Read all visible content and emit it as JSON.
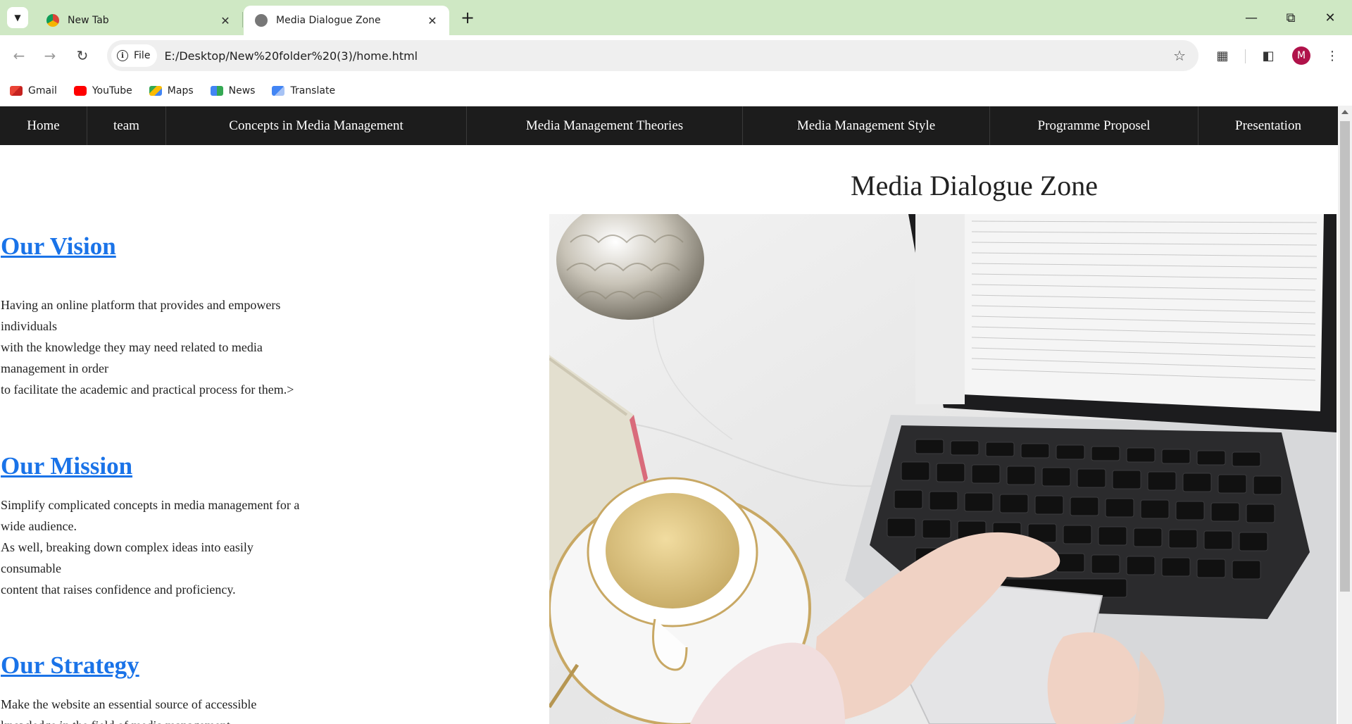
{
  "browser": {
    "tabs": [
      {
        "title": "New Tab",
        "active": false
      },
      {
        "title": "Media Dialogue Zone",
        "active": true
      }
    ],
    "address": {
      "scheme_chip": "File",
      "url": "E:/Desktop/New%20folder%20(3)/home.html"
    },
    "profile_initial": "M",
    "bookmarks": [
      {
        "label": "Gmail",
        "icon": "gmail-icon"
      },
      {
        "label": "YouTube",
        "icon": "youtube-icon"
      },
      {
        "label": "Maps",
        "icon": "maps-icon"
      },
      {
        "label": "News",
        "icon": "news-icon"
      },
      {
        "label": "Translate",
        "icon": "translate-icon"
      }
    ]
  },
  "site": {
    "nav": [
      "Home",
      "team",
      "Concepts in Media Management",
      "Media Management Theories",
      "Media Management Style",
      "Programme Proposel",
      "Presentation"
    ],
    "brand": "Media Dialogue Zone",
    "sections": [
      {
        "heading": "Our Vision",
        "lines": [
          "Having an online platform that provides and empowers",
          "individuals",
          "with the knowledge they may need related to media",
          "management in order",
          "to facilitate the academic and practical process for them.>"
        ]
      },
      {
        "heading": "Our Mission",
        "lines": [
          "Simplify complicated concepts in media management for a",
          "wide audience.",
          "As well, breaking down complex ideas into easily",
          "consumable",
          "content that raises confidence and proficiency."
        ]
      },
      {
        "heading": "Our Strategy",
        "lines": [
          "Make the website an essential source of accessible",
          "knowledge in the field of media management."
        ]
      }
    ]
  },
  "colors": {
    "tabbar": "#cfe8c4",
    "nav_bg": "#1c1c1c",
    "link": "#1a73e8"
  }
}
